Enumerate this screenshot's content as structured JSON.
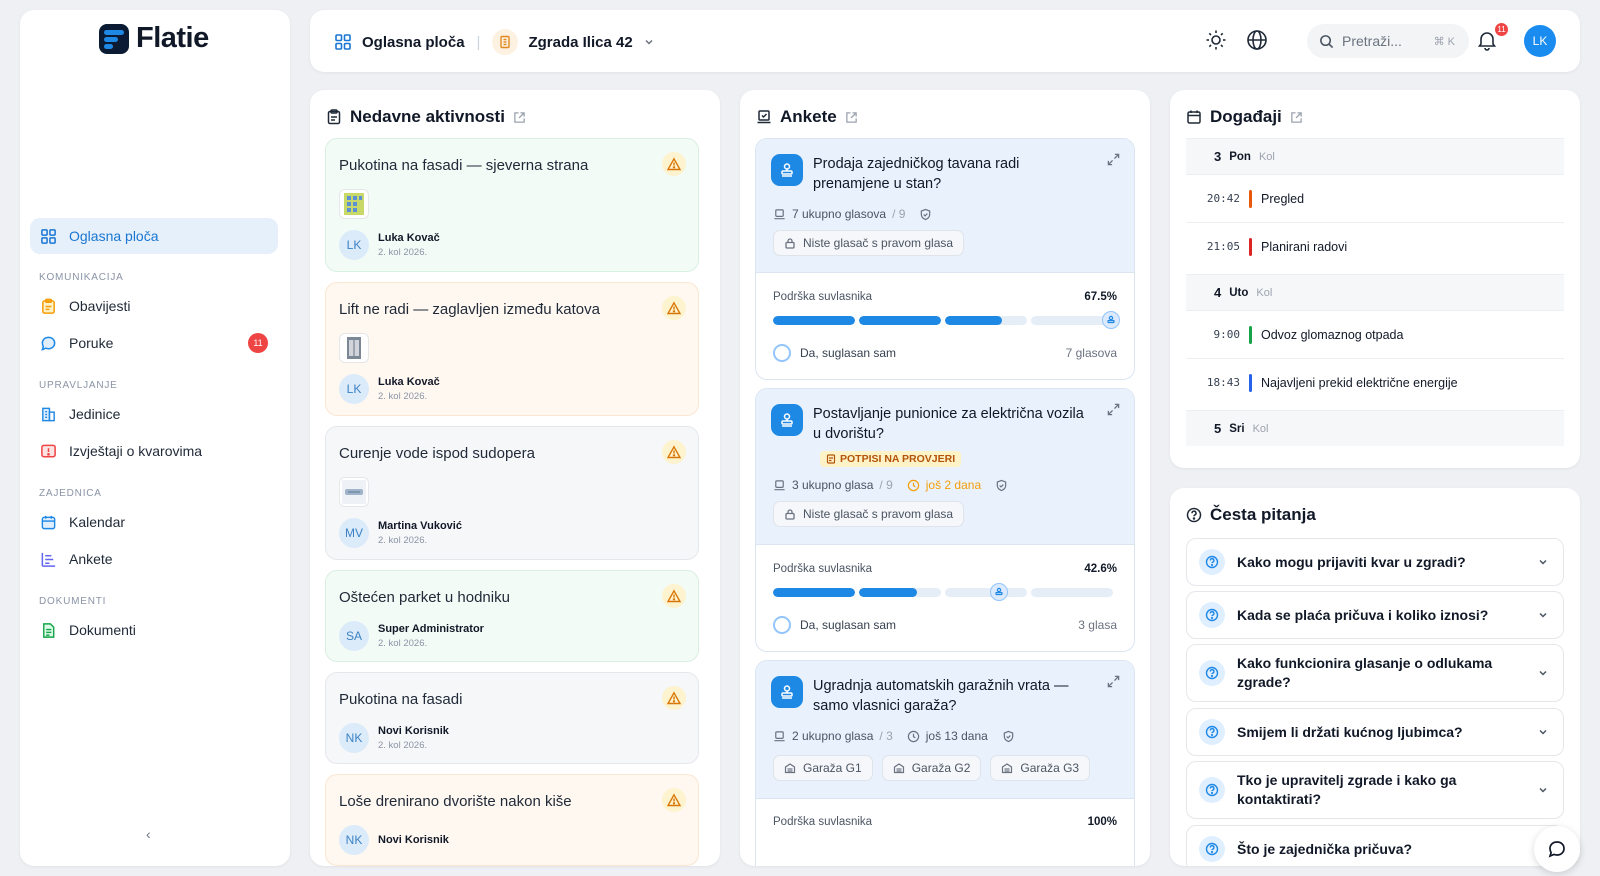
{
  "app": {
    "name": "Flatie"
  },
  "sidebar": {
    "active": {
      "label": "Oglasna ploča"
    },
    "sections": [
      {
        "title": "KOMUNIKACIJA",
        "items": [
          {
            "label": "Obavijesti"
          },
          {
            "label": "Poruke",
            "badge": "11"
          }
        ]
      },
      {
        "title": "UPRAVLJANJE",
        "items": [
          {
            "label": "Jedinice"
          },
          {
            "label": "Izvještaji o kvarovima"
          }
        ]
      },
      {
        "title": "ZAJEDNICA",
        "items": [
          {
            "label": "Kalendar"
          },
          {
            "label": "Ankete"
          }
        ]
      },
      {
        "title": "DOKUMENTI",
        "items": [
          {
            "label": "Dokumenti"
          }
        ]
      }
    ],
    "collapse": "‹"
  },
  "header": {
    "page": "Oglasna ploča",
    "building": "Zgrada Ilica 42",
    "search_placeholder": "Pretraži...",
    "search_shortcut": "⌘ K",
    "notifications": "11",
    "user_initials": "LK"
  },
  "activities": {
    "title": "Nedavne aktivnosti",
    "items": [
      {
        "title": "Pukotina na fasadi — sjeverna strana",
        "initials": "LK",
        "name": "Luka Kovač",
        "date": "2. kol 2026."
      },
      {
        "title": "Lift ne radi — zaglavljen između katova",
        "initials": "LK",
        "name": "Luka Kovač",
        "date": "2. kol 2026."
      },
      {
        "title": "Curenje vode ispod sudopera",
        "initials": "MV",
        "name": "Martina Vuković",
        "date": "2. kol 2026."
      },
      {
        "title": "Oštećen parket u hodniku",
        "initials": "SA",
        "name": "Super Administrator",
        "date": "2. kol 2026."
      },
      {
        "title": "Pukotina na fasadi",
        "initials": "NK",
        "name": "Novi Korisnik",
        "date": "2. kol 2026."
      },
      {
        "title": "Loše drenirano dvorište nakon kiše",
        "initials": "NK",
        "name": "Novi Korisnik",
        "date": ""
      }
    ]
  },
  "polls": {
    "title": "Ankete",
    "support_label": "Podrška suvlasnika",
    "agree_label": "Da, suglasan sam",
    "no_right": "Niste glasač s pravom glasa",
    "items": [
      {
        "title": "Prodaja zajedničkog tavana radi prenamjene u stan?",
        "votes": "7 ukupno glasova",
        "total": "/ 9",
        "support": "67.5%",
        "support_fraction": 0.675,
        "count": "7 glasova"
      },
      {
        "title": "Postavljanje punionice za električna vozila u dvorištu?",
        "status": "POTPISI NA PROVJERI",
        "votes": "3 ukupno glasa",
        "total": "/ 9",
        "deadline": "još 2 dana",
        "support": "42.6%",
        "support_fraction": 0.426,
        "count": "3 glasa"
      },
      {
        "title": "Ugradnja automatskih garažnih vrata — samo vlasnici garaža?",
        "votes": "2 ukupno glasa",
        "total": "/ 3",
        "deadline": "još 13 dana",
        "chips": [
          "Garaža G1",
          "Garaža G2",
          "Garaža G3"
        ],
        "support": "100%",
        "support_fraction": 1.0
      }
    ]
  },
  "events": {
    "title": "Događaji",
    "days": [
      {
        "num": "3",
        "day": "Pon",
        "month": "Kol",
        "events": [
          {
            "time": "20:42",
            "name": "Pregled",
            "color": "#ea580c"
          },
          {
            "time": "21:05",
            "name": "Planirani radovi",
            "color": "#dc2626"
          }
        ]
      },
      {
        "num": "4",
        "day": "Uto",
        "month": "Kol",
        "events": [
          {
            "time": "9:00",
            "name": "Odvoz glomaznog otpada",
            "color": "#16a34a"
          },
          {
            "time": "18:43",
            "name": "Najavljeni prekid električne energije",
            "color": "#2563eb"
          }
        ]
      },
      {
        "num": "5",
        "day": "Sri",
        "month": "Kol",
        "events": []
      }
    ]
  },
  "faq": {
    "title": "Česta pitanja",
    "items": [
      "Kako mogu prijaviti kvar u zgradi?",
      "Kada se plaća pričuva i koliko iznosi?",
      "Kako funkcionira glasanje o odlukama zgrade?",
      "Smijem li držati kućnog ljubimca?",
      "Tko je upravitelj zgrade i kako ga kontaktirati?",
      "Što je zajednička pričuva?"
    ]
  },
  "colors": {
    "accent": "#1e88e5",
    "danger": "#ef4444",
    "warning": "#f59e0b"
  }
}
